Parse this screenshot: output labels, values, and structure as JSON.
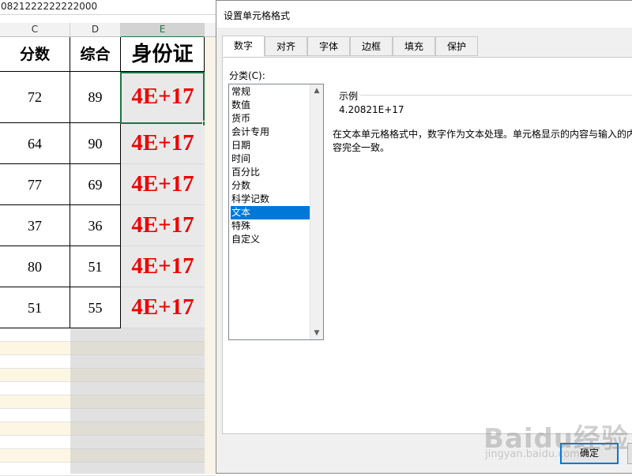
{
  "formula_bar": {
    "value": "0821222222222000"
  },
  "columns": [
    {
      "letter": "C",
      "header": "分数"
    },
    {
      "letter": "D",
      "header": "综合"
    },
    {
      "letter": "E",
      "header": "身份证"
    }
  ],
  "rows": [
    {
      "c": "72",
      "d": "89",
      "e": "4E+17"
    },
    {
      "c": "64",
      "d": "90",
      "e": "4E+17"
    },
    {
      "c": "77",
      "d": "69",
      "e": "4E+17"
    },
    {
      "c": "37",
      "d": "36",
      "e": "4E+17"
    },
    {
      "c": "80",
      "d": "51",
      "e": "4E+17"
    },
    {
      "c": "51",
      "d": "55",
      "e": "4E+17"
    }
  ],
  "dialog": {
    "title": "设置单元格格式",
    "tabs": [
      "数字",
      "对齐",
      "字体",
      "边框",
      "填充",
      "保护"
    ],
    "active_tab": "数字",
    "category_label": "分类(C):",
    "categories": [
      "常规",
      "数值",
      "货币",
      "会计专用",
      "日期",
      "时间",
      "百分比",
      "分数",
      "科学记数",
      "文本",
      "特殊",
      "自定义"
    ],
    "selected_category": "文本",
    "sample_label": "示例",
    "sample_value": "4.20821E+17",
    "description": "在文本单元格格式中，数字作为文本处理。单元格显示的内容与输入的内容完全一致。",
    "ok_label": "确定"
  },
  "watermark": {
    "logo": "Baidu经验",
    "url": "jingyan.baidu.com"
  },
  "colors": {
    "accent": "#217346",
    "selection": "#0078d7",
    "id_text": "#ee0000"
  }
}
